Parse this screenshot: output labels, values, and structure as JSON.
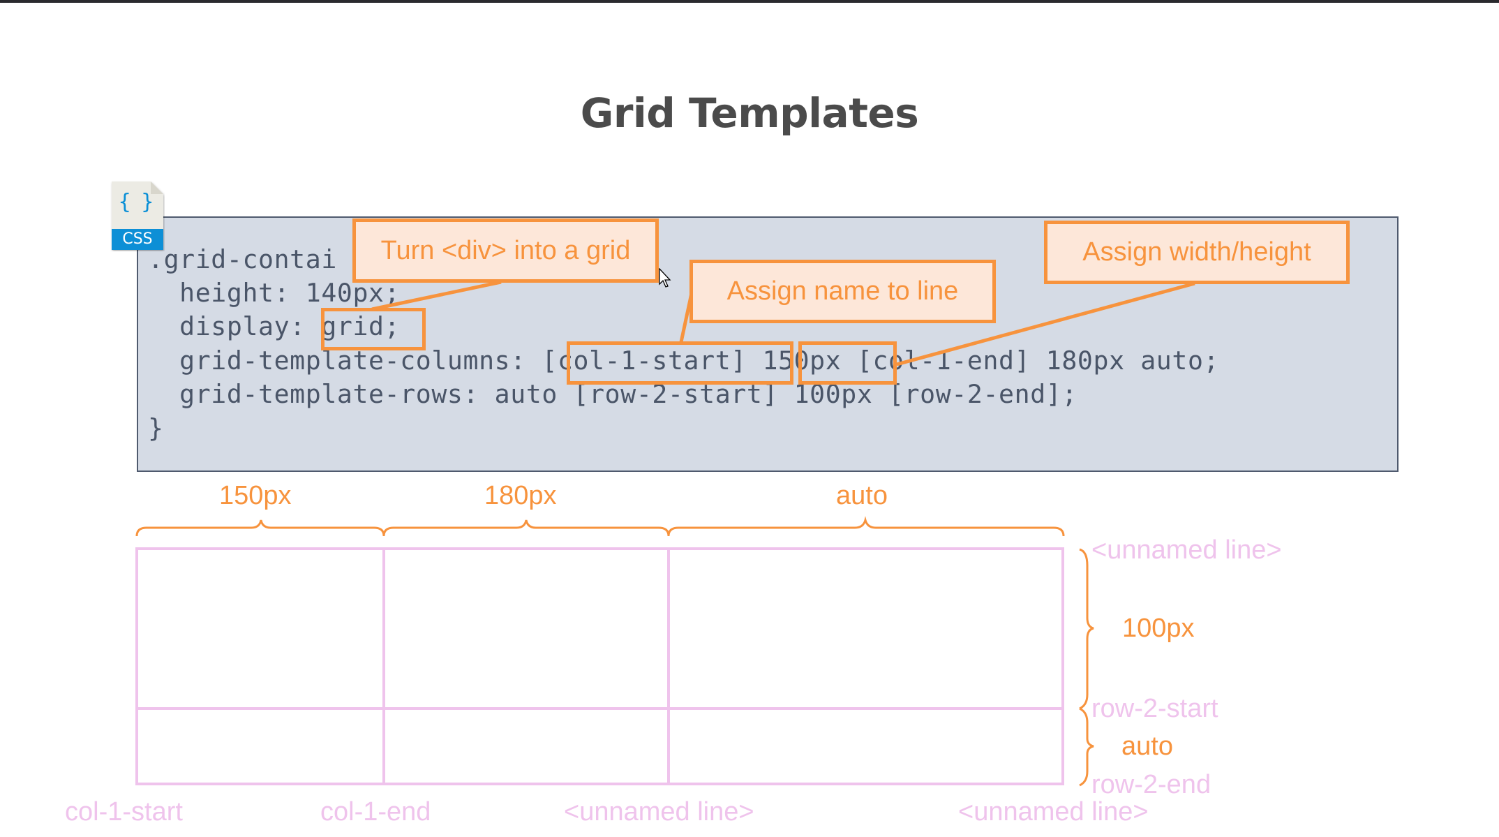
{
  "title": "Grid Templates",
  "file_icon": {
    "label": "CSS",
    "glyph": "{ }",
    "icon": "css-file-icon",
    "band_color": "#0a8fd6"
  },
  "code": {
    "lines": [
      ".grid-container {",
      "  height: 140px;",
      "  display: grid;",
      "  grid-template-columns: [col-1-start] 150px [col-1-end] 180px auto;",
      "  grid-template-rows: auto [row-2-start] 100px [row-2-end];",
      "}"
    ],
    "line1_visible": ".grid-contai",
    "line3_prefix": "  display: ",
    "line3_highlight": "grid;",
    "line4_prefix": "  grid-template-columns: ",
    "line4_highlight1": "[col-1-start]",
    "line4_highlight2": "150px",
    "line4_suffix": " [col-1-end] 180px auto;",
    "line2": "  height: 140px;",
    "line5": "  grid-template-rows: auto [row-2-start] 100px [row-2-end];",
    "line6": "}"
  },
  "callouts": [
    {
      "id": "display-grid",
      "text": "Turn <div> into a grid"
    },
    {
      "id": "line-name",
      "text": "Assign name to line"
    },
    {
      "id": "track-size",
      "text": "Assign width/height"
    }
  ],
  "diagram": {
    "column_sizes": [
      "150px",
      "180px",
      "auto"
    ],
    "row_sizes": [
      "100px",
      "auto"
    ],
    "column_line_names": [
      "col-1-start",
      "col-1-end",
      "<unnamed line>",
      "<unnamed line>"
    ],
    "row_line_names": [
      "<unnamed line>",
      "row-2-start",
      "row-2-end"
    ],
    "colors": {
      "grid_lines": "#efc3ec",
      "braces": "#f7933d",
      "labels": "#efc3ec",
      "sizes": "#f7933d"
    }
  }
}
